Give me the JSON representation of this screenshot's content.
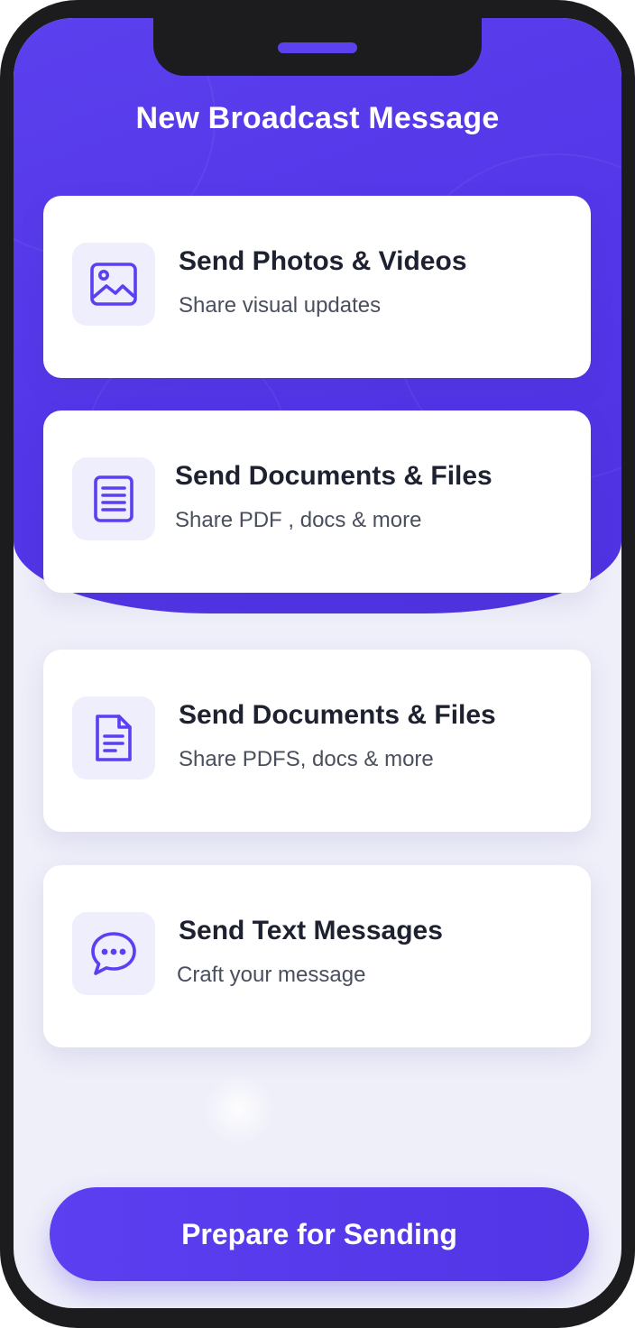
{
  "screen": {
    "title": "New Broadcast Message"
  },
  "options": [
    {
      "title": "Send Photos & Videos",
      "subtitle": "Share visual updates",
      "icon": "image-icon"
    },
    {
      "title": "Send Documents & Files",
      "subtitle": "Share PDF , docs & more",
      "icon": "document-icon"
    },
    {
      "title": "Send Documents & Files",
      "subtitle": "Share PDFS, docs & more",
      "icon": "file-icon"
    },
    {
      "title": "Send Text Messages",
      "subtitle": "Craft your message",
      "icon": "chat-bubble-icon"
    }
  ],
  "actions": {
    "prepare_label": "Prepare for Sending"
  },
  "colors": {
    "accent": "#5b3ff0",
    "icon_background": "#efeefd",
    "screen_background": "#eeeff9",
    "title_text": "#1e2230",
    "subtitle_text": "#4a4f5e"
  }
}
